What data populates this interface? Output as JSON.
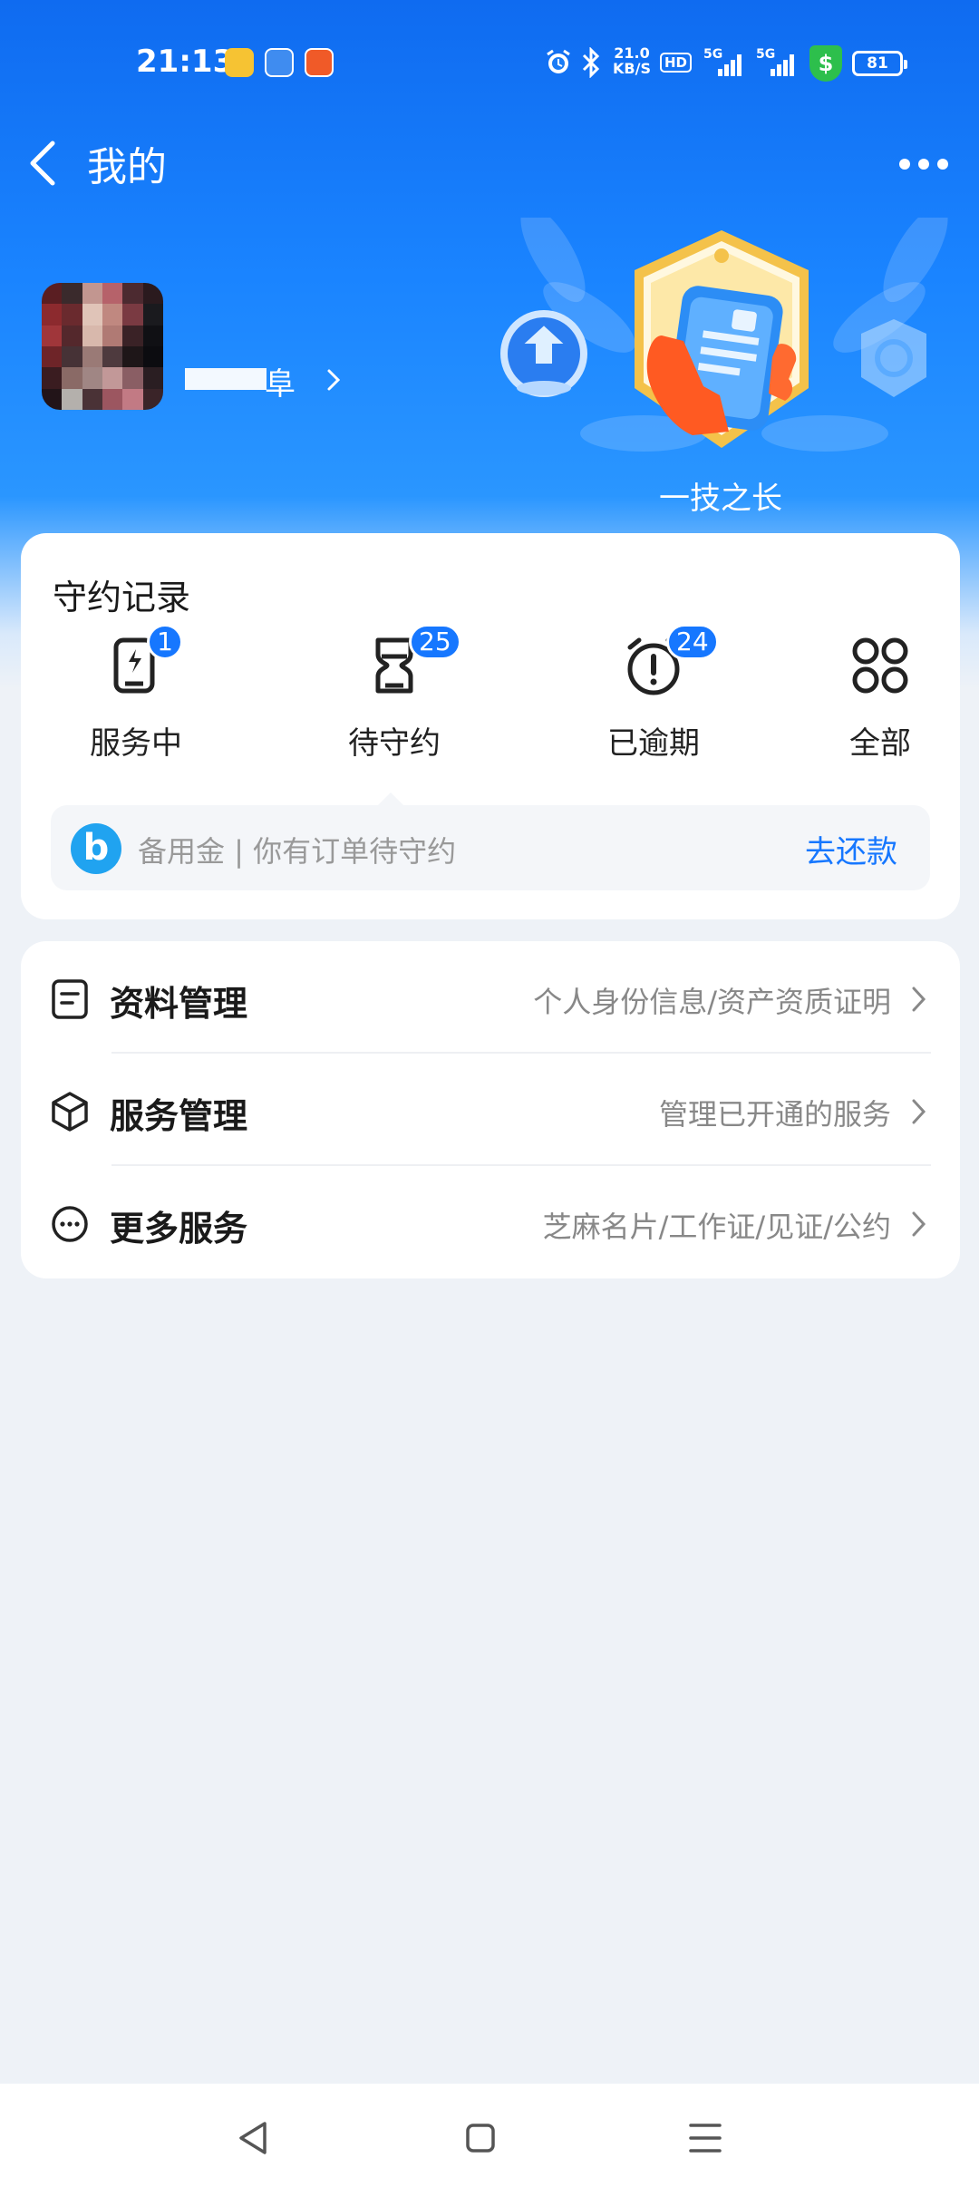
{
  "status_bar": {
    "time": "21:13",
    "net_speed_value": "21.0",
    "net_speed_unit": "KB/S",
    "hd_label": "HD",
    "sim1_label": "5G",
    "sim2_label": "5G",
    "shield_symbol": "$",
    "battery": "81",
    "icons": [
      "alarm-icon",
      "bluetooth-icon",
      "shield-icon",
      "battery-icon"
    ]
  },
  "nav": {
    "title": "我的"
  },
  "profile": {
    "username_visible": "阜",
    "badge_caption": "一技之长"
  },
  "records": {
    "title": "守约记录",
    "items": [
      {
        "label": "服务中",
        "badge": "1",
        "icon": "service-phone-icon"
      },
      {
        "label": "待守约",
        "badge": "25",
        "icon": "hourglass-icon"
      },
      {
        "label": "已逾期",
        "badge": "24",
        "icon": "alarm-clock-icon"
      },
      {
        "label": "全部",
        "badge": "",
        "icon": "grid-icon"
      }
    ],
    "notice": {
      "logo": "b",
      "text": "备用金 | 你有订单待守约",
      "action": "去还款"
    }
  },
  "menu": [
    {
      "label": "资料管理",
      "sub": "个人身份信息/资产资质证明",
      "icon": "document-icon"
    },
    {
      "label": "服务管理",
      "sub": "管理已开通的服务",
      "icon": "box-icon"
    },
    {
      "label": "更多服务",
      "sub": "芝麻名片/工作证/见证/公约",
      "icon": "more-circle-icon"
    }
  ],
  "colors": {
    "brand_blue": "#1677ff",
    "hero_blue": "#0f6bf0",
    "page_bg": "#eef2f7",
    "shield_green": "#2dbf4c"
  }
}
